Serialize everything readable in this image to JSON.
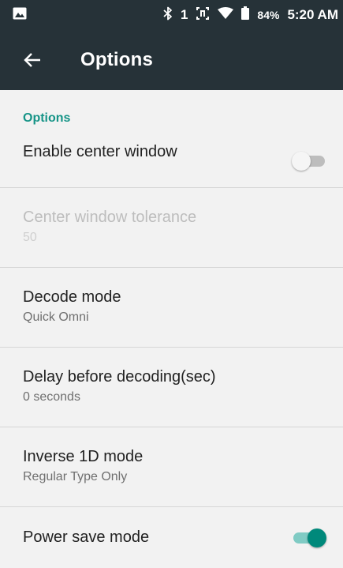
{
  "status_bar": {
    "battery_percent": "84%",
    "time": "5:20 AM",
    "sim_slot": "1",
    "icons": [
      "image-icon",
      "bluetooth-icon",
      "sim-1-indicator",
      "nfc-icon",
      "wifi-icon",
      "battery-icon"
    ]
  },
  "toolbar": {
    "title": "Options",
    "back_icon": "arrow-left-icon"
  },
  "section": {
    "header": "Options"
  },
  "prefs": {
    "center_window": {
      "title": "Enable center window",
      "checked": false
    },
    "tolerance": {
      "title": "Center window tolerance",
      "summary": "50",
      "enabled": false
    },
    "decode_mode": {
      "title": "Decode mode",
      "summary": "Quick Omni"
    },
    "delay": {
      "title": "Delay before decoding(sec)",
      "summary": "0 seconds"
    },
    "inverse": {
      "title": "Inverse 1D mode",
      "summary": "Regular Type Only"
    },
    "power_save": {
      "title": "Power save mode",
      "checked": true
    }
  },
  "colors": {
    "toolbar_bg": "#263238",
    "accent": "#00897b",
    "section_header": "#169487"
  }
}
